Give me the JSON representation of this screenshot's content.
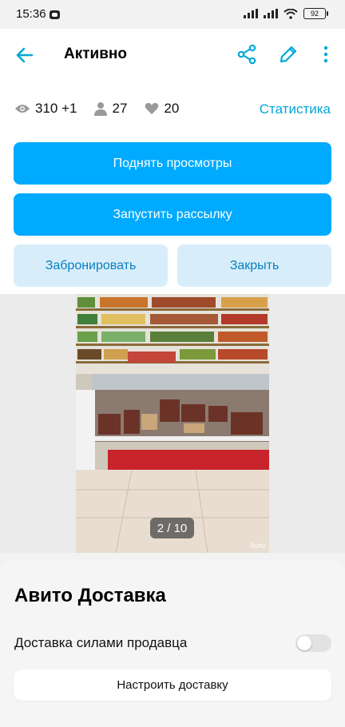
{
  "status_bar": {
    "time": "15:36",
    "battery": "92"
  },
  "app_bar": {
    "title": "Активно"
  },
  "stats": {
    "views": "310 +1",
    "contacts": "27",
    "favorites": "20",
    "link": "Статистика"
  },
  "buttons": {
    "raise_views": "Поднять просмотры",
    "start_mailing": "Запустить рассылку",
    "reserve": "Забронировать",
    "close": "Закрыть"
  },
  "gallery": {
    "counter": "2 / 10",
    "watermark": "Avito"
  },
  "delivery": {
    "title": "Авито Доставка",
    "seller_delivery_label": "Доставка силами продавца",
    "seller_delivery_enabled": false,
    "setup_button": "Настроить доставку"
  },
  "colors": {
    "accent": "#00aaff",
    "link": "#00a8d6",
    "light_button": "#d7eefa"
  }
}
